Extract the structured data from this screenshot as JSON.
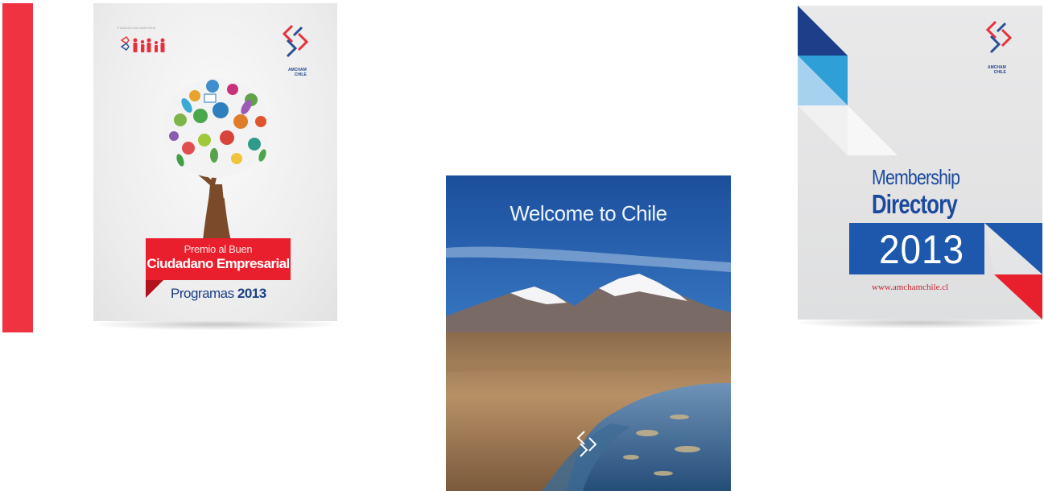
{
  "covers": {
    "premio": {
      "org_small": "FUNDACION AMCHAM",
      "banner_line1": "Premio al Buen",
      "banner_line2": "Ciudadano Empresarial",
      "programs_label": "Programas",
      "programs_year": "2013",
      "logo_line1": "AMCHAM",
      "logo_line2": "CHILE"
    },
    "welcome": {
      "title": "Welcome to Chile"
    },
    "directory": {
      "title_line1": "Membership",
      "title_line2": "Directory",
      "year": "2013",
      "url": "www.amchamchile.cl",
      "logo_line1": "AMCHAM",
      "logo_line2": "CHILE"
    }
  },
  "colors": {
    "accent_red": "#ef3340",
    "brand_blue": "#1e58ad",
    "banner_red": "#ea1f2d"
  }
}
